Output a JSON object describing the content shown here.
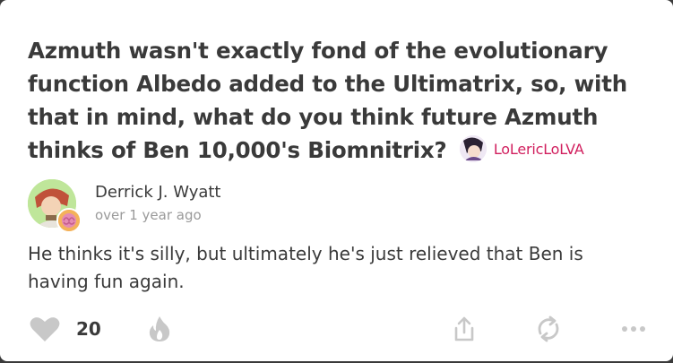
{
  "question": {
    "text": "Azmuth wasn't exactly fond of the evolutionary function Albedo added to the Ultimatrix, so, with that in mind, what do you think future Azmuth thinks of Ben 10,000's Biomnitrix?",
    "asker_name": "LoLericLoLVA"
  },
  "answer": {
    "author": "Derrick J. Wyatt",
    "timestamp": "over 1 year ago",
    "text": "He thinks it's silly, but ultimately he's just relieved that Ben is having fun again."
  },
  "actions": {
    "like_count": "20",
    "icons": {
      "like": "heart-icon",
      "fire": "flame-icon",
      "share": "share-icon",
      "repost": "repost-icon",
      "more": "ellipsis-icon"
    }
  },
  "colors": {
    "text": "#3a3a3a",
    "muted": "#9a9a9a",
    "asker_accent": "#d11f5e",
    "icon": "#c8c8c8"
  }
}
